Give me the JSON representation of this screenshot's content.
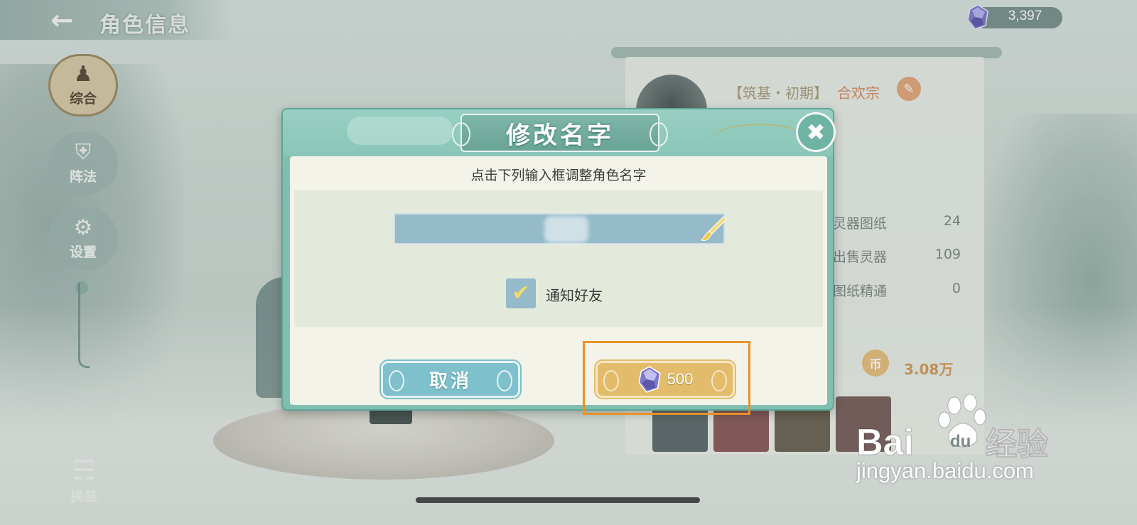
{
  "top_bar": {
    "title": "角色信息",
    "back_icon": "back-arrow-icon"
  },
  "currency": {
    "icon": "crystal-gem-icon",
    "value": "3,397"
  },
  "side_nav": {
    "items": [
      {
        "label": "综合",
        "icon": "character-icon",
        "active": true
      },
      {
        "label": "阵法",
        "icon": "shield-icon",
        "active": false
      },
      {
        "label": "设置",
        "icon": "gear-icon",
        "active": false
      }
    ],
    "outfit_label": "换装",
    "outfit_icon": "clothing-icon"
  },
  "right_panel": {
    "rank": "【筑基・初期】",
    "rank_tag": "合欢宗",
    "stats": [
      {
        "label": "灵器图纸",
        "value": "24"
      },
      {
        "label": "出售灵器",
        "value": "109"
      },
      {
        "label": "图纸精通",
        "value": "0"
      }
    ],
    "coin_icon": "币",
    "coin_value": "3.08万"
  },
  "dialog": {
    "title": "修改名字",
    "close_icon": "close-x-icon",
    "instruction": "点击下列输入框调整角色名字",
    "name_input": {
      "value": "",
      "icon": "brush-icon"
    },
    "notify": {
      "label": "通知好友",
      "checked": true
    },
    "cancel_label": "取消",
    "confirm_cost": "500",
    "confirm_icon": "crystal-gem-icon"
  },
  "watermark": {
    "text": "jingyan.baidu.com",
    "brand_latin": "Bai",
    "brand_du": "du",
    "brand_cn": "经验"
  },
  "colors": {
    "dialog_teal": "#7fbfb0",
    "cancel_blue": "#7ec0cc",
    "confirm_gold": "#e3bc6b",
    "highlight_orange": "#e8922a"
  }
}
